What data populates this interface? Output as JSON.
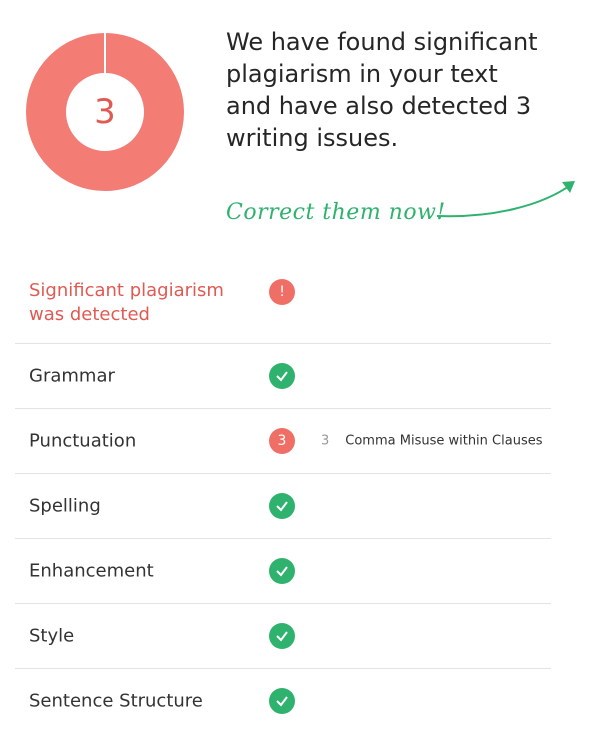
{
  "summary": {
    "issue_count": "3",
    "headline": "We have found significant plagiarism in your text and have also detected 3 writing issues.",
    "cta": "Correct them now!"
  },
  "checks": [
    {
      "label": "Significant plagiarism was detected",
      "status": "error",
      "status_text": "!"
    },
    {
      "label": "Grammar",
      "status": "ok"
    },
    {
      "label": "Punctuation",
      "status": "issues",
      "status_text": "3",
      "issue_num": "3",
      "issue_text": "Comma Misuse within Clauses"
    },
    {
      "label": "Spelling",
      "status": "ok"
    },
    {
      "label": "Enhancement",
      "status": "ok"
    },
    {
      "label": "Style",
      "status": "ok"
    },
    {
      "label": "Sentence Structure",
      "status": "ok"
    }
  ],
  "colors": {
    "error": "#ef6f66",
    "ok": "#2fb26e",
    "donut": "#f37c75"
  }
}
